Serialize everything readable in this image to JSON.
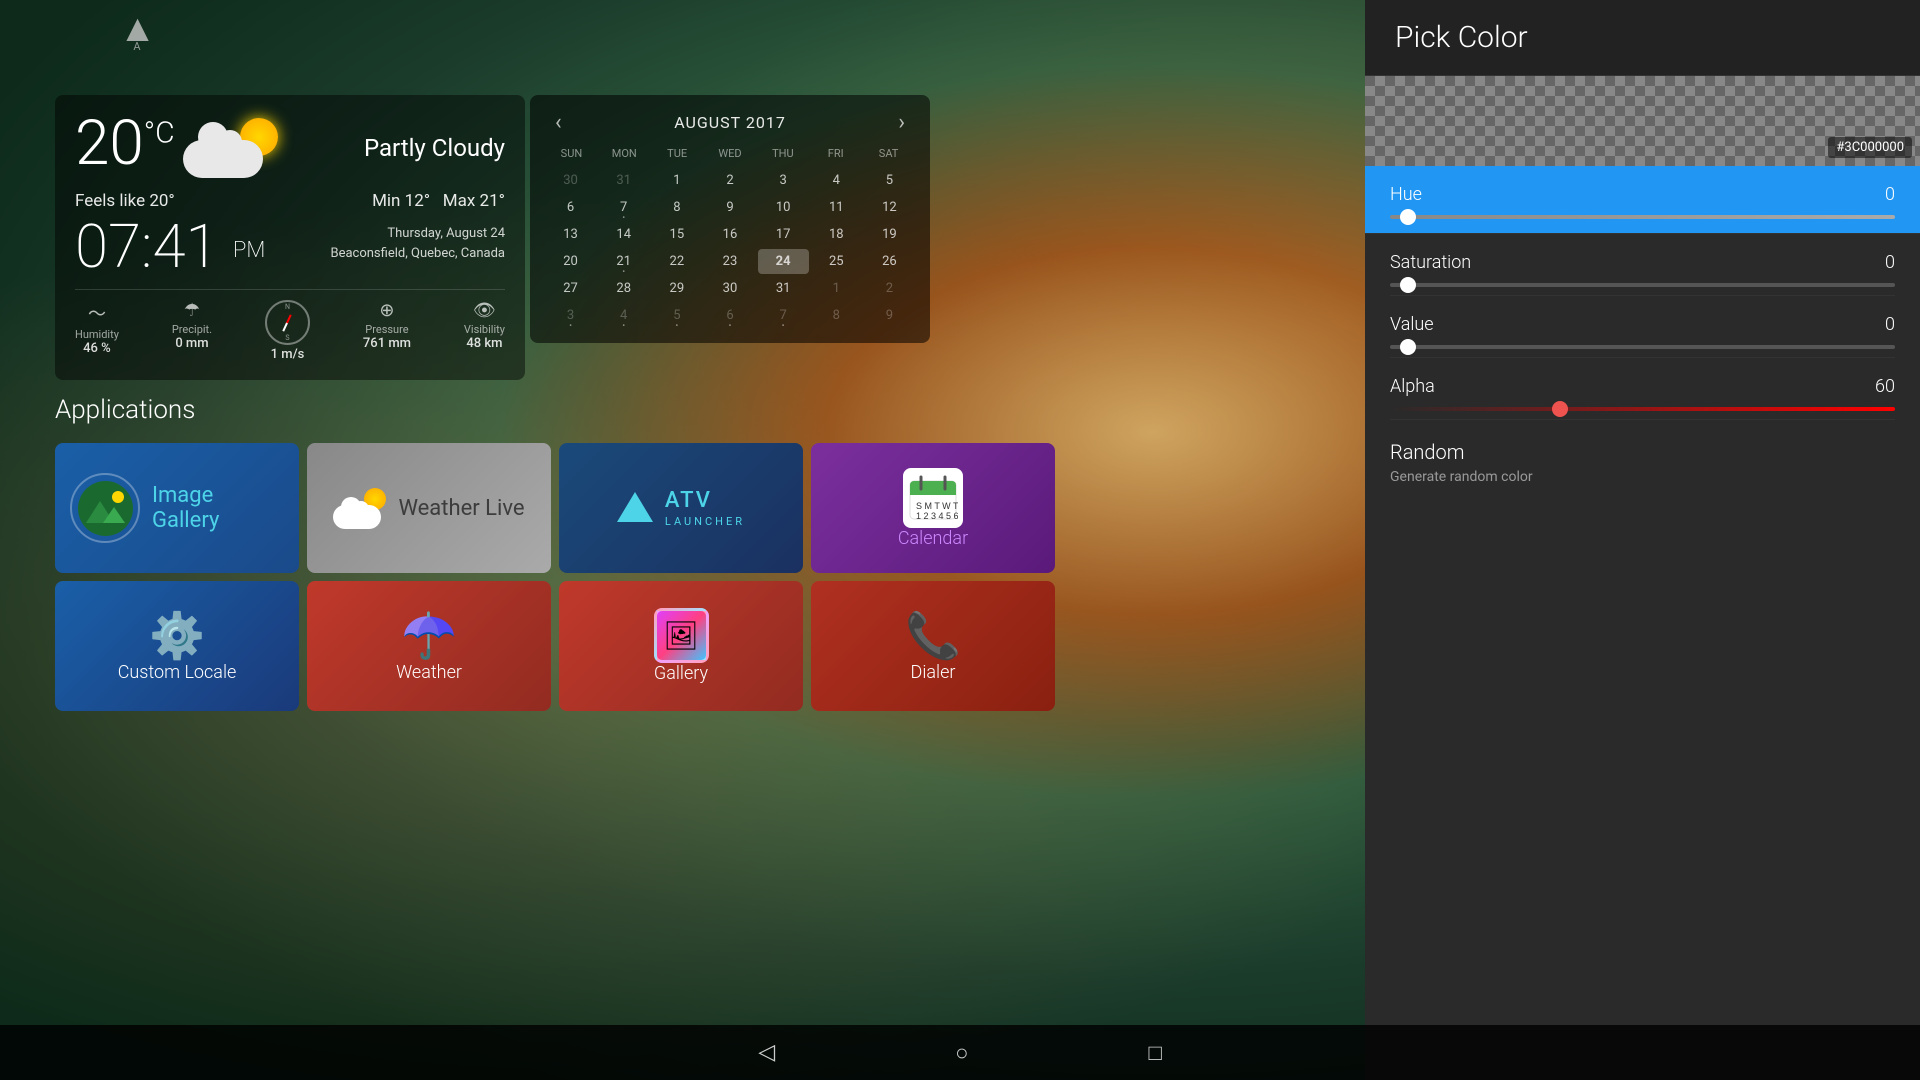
{
  "app": {
    "title": "ATV Launcher"
  },
  "weather": {
    "temperature": "20",
    "unit": "°C",
    "description": "Partly Cloudy",
    "feels_like_label": "Feels like",
    "feels_like_temp": "20°",
    "min_label": "Min",
    "min_temp": "12°",
    "max_label": "Max",
    "max_temp": "21°",
    "time": "07:41",
    "ampm": "PM",
    "date": "Thursday, August 24",
    "location": "Beaconsfield, Quebec, Canada",
    "humidity_label": "Humidity",
    "humidity_value": "46 %",
    "precip_label": "Precipit.",
    "precip_value": "0 mm",
    "wind_value": "1",
    "wind_unit": "m/s",
    "pressure_label": "Pressure",
    "pressure_value": "761 mm",
    "visibility_label": "Visibility",
    "visibility_value": "48 km"
  },
  "calendar": {
    "title": "AUGUST 2017",
    "days_header": [
      "SUN",
      "MON",
      "TUE",
      "WED",
      "THU",
      "FRI",
      "SAT"
    ],
    "weeks": [
      [
        "30",
        "31",
        "1",
        "2",
        "3",
        "4",
        "5"
      ],
      [
        "6",
        "7",
        "8",
        "9",
        "10",
        "11",
        "12"
      ],
      [
        "13",
        "14",
        "15",
        "16",
        "17",
        "18",
        "19"
      ],
      [
        "20",
        "21",
        "22",
        "23",
        "24",
        "25",
        "26"
      ],
      [
        "27",
        "28",
        "29",
        "30",
        "31",
        "1",
        "2"
      ],
      [
        "3",
        "4",
        "5",
        "6",
        "7",
        "8",
        "9"
      ]
    ],
    "today": "24",
    "other_month_start": [
      "30",
      "31"
    ],
    "other_month_end": [
      "1",
      "2",
      "3",
      "4",
      "5",
      "6",
      "7",
      "8",
      "9"
    ]
  },
  "applications": {
    "section_title": "Applications",
    "apps": [
      {
        "id": "image-gallery",
        "name": "Image\nGallery",
        "tile_class": "tile-image-gallery"
      },
      {
        "id": "weather-live",
        "name": "Weather Live",
        "tile_class": "tile-weather-live"
      },
      {
        "id": "atv-launcher",
        "name": "ATV LAUNCHER",
        "tile_class": "tile-atv"
      },
      {
        "id": "calendar",
        "name": "Calendar",
        "tile_class": "tile-calendar"
      },
      {
        "id": "custom-locale",
        "name": "Custom Locale",
        "tile_class": "tile-custom-locale"
      },
      {
        "id": "weather",
        "name": "Weather",
        "tile_class": "tile-weather"
      },
      {
        "id": "gallery",
        "name": "Gallery",
        "tile_class": "tile-gallery"
      },
      {
        "id": "dialer",
        "name": "Dialer",
        "tile_class": "tile-dialer"
      }
    ]
  },
  "navigation": {
    "back_label": "◁",
    "home_label": "○",
    "recents_label": "□"
  },
  "pick_color": {
    "title": "Pick Color",
    "hex_value": "#3C000000",
    "hue_label": "Hue",
    "hue_value": "0",
    "saturation_label": "Saturation",
    "saturation_value": "0",
    "value_label": "Value",
    "value_value": "0",
    "alpha_label": "Alpha",
    "alpha_value": "60",
    "random_label": "Random",
    "random_subtitle": "Generate random color"
  }
}
